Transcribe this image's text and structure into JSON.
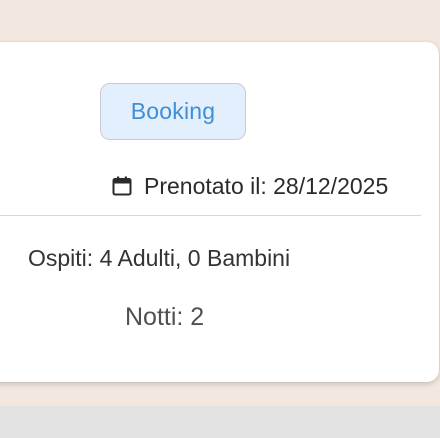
{
  "booking_card": {
    "badge_label": "Booking",
    "booked_on_text": "Prenotato il: 28/12/2025",
    "guests_text": "Ospiti: 4 Adulti, 0 Bambini",
    "nights_text": "Notti: 2"
  },
  "icons": {
    "booked_on": "calendar-icon"
  },
  "colors": {
    "page_background": "#f2e8df",
    "card_background": "#ffffff",
    "badge_background": "#e3effc",
    "badge_text": "#3d8fd8",
    "bottom_bar": "#e3e3e3"
  }
}
